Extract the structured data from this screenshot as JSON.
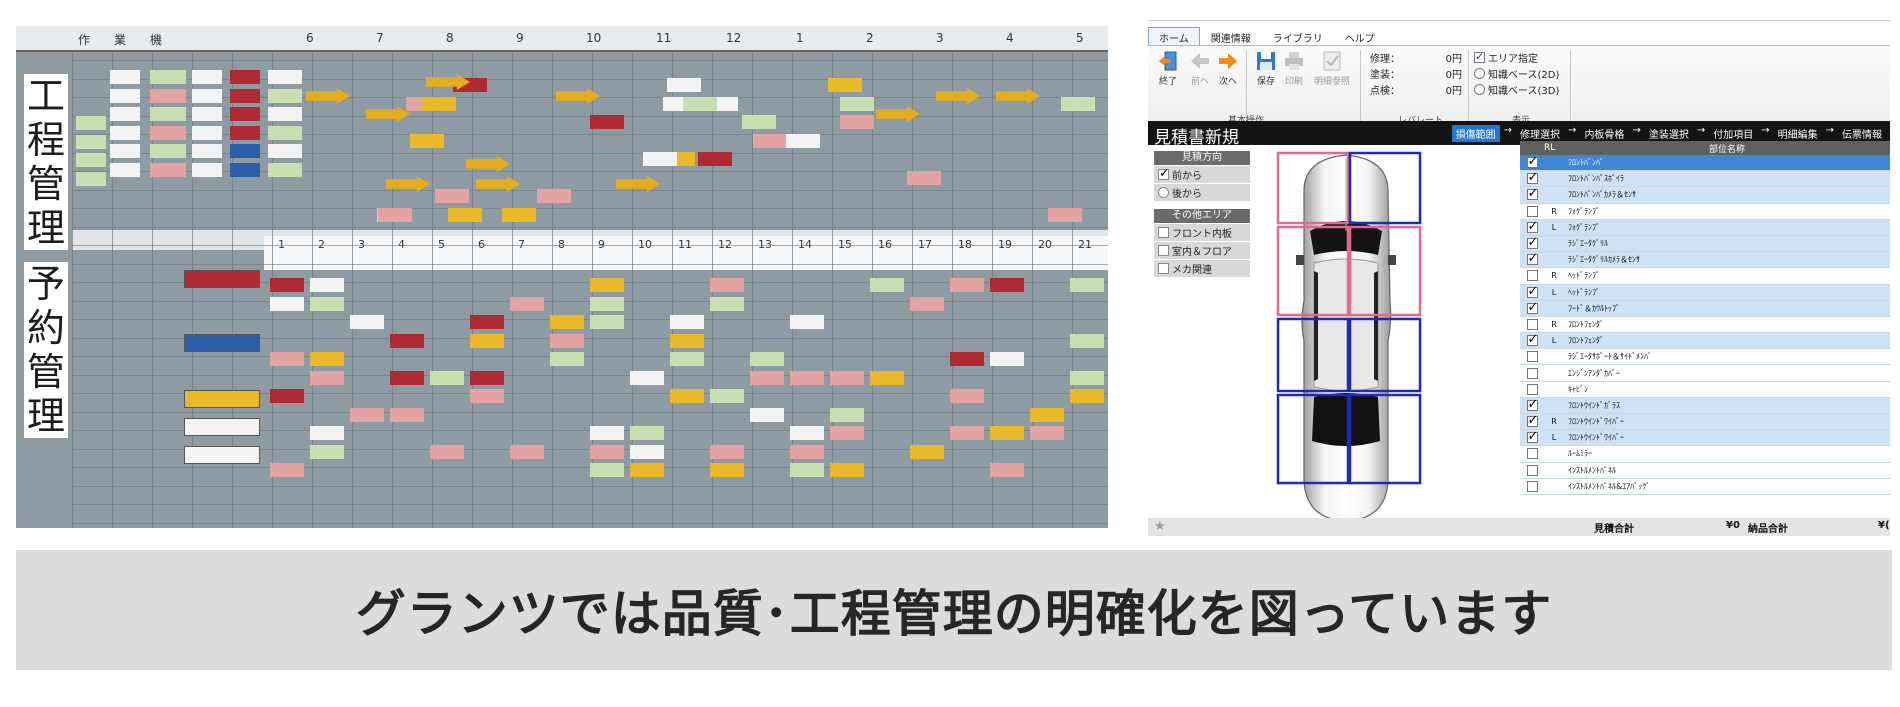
{
  "board": {
    "label_process": [
      "工",
      "程",
      "管",
      "理"
    ],
    "label_reservation": [
      "予",
      "約",
      "管",
      "理"
    ],
    "top_header": [
      "作",
      "業",
      "機",
      "6",
      "7",
      "8",
      "9",
      "10",
      "11",
      "12",
      "1",
      "2",
      "3",
      "4",
      "5"
    ],
    "date_numbers": [
      "1",
      "2",
      "3",
      "4",
      "5",
      "6",
      "7",
      "8",
      "9",
      "10",
      "11",
      "12",
      "13",
      "14",
      "15",
      "16",
      "17",
      "18",
      "19",
      "20",
      "21"
    ]
  },
  "app": {
    "menu_tabs": [
      "ホーム",
      "関連情報",
      "ライブラリ",
      "ヘルプ"
    ],
    "ribbon": {
      "buttons": [
        {
          "label": "終了",
          "icon": "exit-door-icon",
          "enabled": true
        },
        {
          "label": "前へ",
          "icon": "arrow-left-icon",
          "enabled": false
        },
        {
          "label": "次へ",
          "icon": "arrow-right-icon",
          "enabled": true
        },
        {
          "label": "保存",
          "icon": "save-icon",
          "enabled": true
        },
        {
          "label": "印刷",
          "icon": "print-icon",
          "enabled": false
        },
        {
          "label": "明細参照",
          "icon": "details-icon",
          "enabled": false
        }
      ],
      "group_basic": "基本操作",
      "costs": [
        {
          "label": "修理：",
          "value": "0円"
        },
        {
          "label": "塗装：",
          "value": "0円"
        },
        {
          "label": "点検：",
          "value": "0円"
        }
      ],
      "group_rate": "レバレート",
      "options": [
        {
          "label": "エリア指定",
          "type": "check",
          "checked": true
        },
        {
          "label": "知識ベース(2D)",
          "type": "radio",
          "checked": false
        },
        {
          "label": "知識ベース(3D)",
          "type": "radio",
          "checked": false
        }
      ],
      "group_display": "表示"
    },
    "title": "見積書新規",
    "steps": [
      "損傷範囲",
      "修理選択",
      "内板骨格",
      "塗装選択",
      "付加項目",
      "明細編集",
      "伝票情報"
    ],
    "step_separator": "→",
    "left_panel": {
      "direction_header": "見積方向",
      "directions": [
        {
          "label": "前から",
          "checked": true
        },
        {
          "label": "後から",
          "checked": false
        }
      ],
      "other_header": "その他エリア",
      "others": [
        "フロント内板",
        "室内＆フロア",
        "メカ関連"
      ]
    },
    "parts_table": {
      "header_rl": "RL",
      "header_name": "部位名称",
      "rows": [
        {
          "checked": true,
          "rl": "",
          "name": "ﾌﾛﾝﾄﾊﾞﾝﾊﾟ",
          "state": "sel"
        },
        {
          "checked": true,
          "rl": "",
          "name": "ﾌﾛﾝﾄﾊﾞﾝﾊﾟｽﾎﾟｲﾗ",
          "state": "on"
        },
        {
          "checked": true,
          "rl": "",
          "name": "ﾌﾛﾝﾄﾊﾞﾝﾊﾟｶﾒﾗ＆ｾﾝｻ",
          "state": "on"
        },
        {
          "checked": false,
          "rl": "R",
          "name": "ﾌｫｸﾞﾗﾝﾌﾟ",
          "state": ""
        },
        {
          "checked": true,
          "rl": "L",
          "name": "ﾌｫｸﾞﾗﾝﾌﾟ",
          "state": "on"
        },
        {
          "checked": true,
          "rl": "",
          "name": "ﾗｼﾞｴｰﾀｸﾞﾘﾙ",
          "state": "on"
        },
        {
          "checked": true,
          "rl": "",
          "name": "ﾗｼﾞｴｰﾀｸﾞﾘﾙｶﾒﾗ＆ｾﾝｻ",
          "state": "on"
        },
        {
          "checked": false,
          "rl": "R",
          "name": "ﾍｯﾄﾞﾗﾝﾌﾟ",
          "state": ""
        },
        {
          "checked": true,
          "rl": "L",
          "name": "ﾍｯﾄﾞﾗﾝﾌﾟ",
          "state": "on"
        },
        {
          "checked": true,
          "rl": "",
          "name": "ﾌｰﾄﾞ＆ｶｳﾙﾄｯﾌﾟ",
          "state": "on"
        },
        {
          "checked": false,
          "rl": "R",
          "name": "ﾌﾛﾝﾄﾌｪﾝﾀﾞ",
          "state": ""
        },
        {
          "checked": true,
          "rl": "L",
          "name": "ﾌﾛﾝﾄﾌｪﾝﾀﾞ",
          "state": "on"
        },
        {
          "checked": false,
          "rl": "",
          "name": "ﾗｼﾞｴｰﾀｻﾎﾟｰﾄ＆ｻｲﾄﾞﾒﾝﾊﾞ",
          "state": ""
        },
        {
          "checked": false,
          "rl": "",
          "name": "ｴﾝｼﾞﾝｱﾝﾀﾞｶﾊﾞｰ",
          "state": ""
        },
        {
          "checked": false,
          "rl": "",
          "name": "ｷｬﾋﾞﾝ",
          "state": ""
        },
        {
          "checked": true,
          "rl": "",
          "name": "ﾌﾛﾝﾄｳｲﾝﾄﾞｶﾞﾗｽ",
          "state": "on"
        },
        {
          "checked": true,
          "rl": "R",
          "name": "ﾌﾛﾝﾄｳｲﾝﾄﾞﾜｲﾊﾟｰ",
          "state": "on"
        },
        {
          "checked": true,
          "rl": "L",
          "name": "ﾌﾛﾝﾄｳｲﾝﾄﾞﾜｲﾊﾟｰ",
          "state": "on"
        },
        {
          "checked": false,
          "rl": "",
          "name": "ﾙｰﾑﾐﾗｰ",
          "state": ""
        },
        {
          "checked": false,
          "rl": "",
          "name": "ｲﾝｽﾄﾙﾒﾝﾄﾊﾟﾈﾙ",
          "state": ""
        },
        {
          "checked": false,
          "rl": "",
          "name": "ｲﾝｽﾄﾙﾒﾝﾄﾊﾟﾈﾙ&ｴｱﾊﾞｯｸﾞ",
          "state": ""
        }
      ]
    },
    "footer": {
      "estimate_label": "見積合計",
      "estimate_value": "¥0",
      "delivery_label": "納品合計",
      "delivery_value": "¥("
    },
    "colors": {
      "selected_zone": "#e06a8c",
      "unselected_zone": "#1f2ab8",
      "active_step": "#1e78d6"
    }
  },
  "caption": "グランツでは品質･工程管理の明確化を図っています"
}
